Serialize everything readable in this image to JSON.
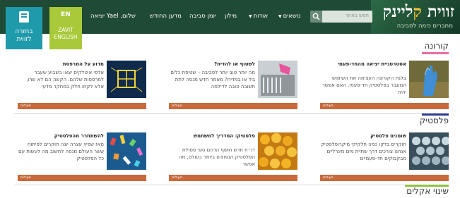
{
  "header": {
    "logo_main": "זווית",
    "logo_accent": "ק",
    "logo_rest": "ליינ",
    "logo_tail": "ק",
    "logo_subtitle": "מחברים כימה לסביבה",
    "search_placeholder": "חפש באתר",
    "nav": {
      "topics": "נושאים",
      "about": "אודות",
      "glossary": "מילון",
      "diary": "יומן סביבה",
      "monthly": "מדען החודש"
    },
    "user_text": "שלום, Yael  יציאה",
    "en_label": "EN",
    "en_sub": "ZAVIT ENGLISH",
    "choose_line1": "בחזרה",
    "choose_line2": "לזווית"
  },
  "sections": [
    {
      "title": "קורונה",
      "color": "#e86fa0",
      "cards": [
        {
          "title": "אסטרטגיית יציאה מהחד-פעמי",
          "text": "בלנת הקורונה העצימה את השימוש המוגבר בפלסטיק חד-פעמי. האם אפשר יהיה",
          "tag": "פעילות"
        },
        {
          "title": "לשטוף או להדיח?",
          "text": "מה יותר טוב יותר לסביבה – שטיפת כלים ביד או במדיח? מאמר חדש מנסה לתת תשובה טובה לדילמה",
          "tag": "פעילות"
        },
        {
          "title": "מדוע על המרפסת",
          "text": "אלפי איטלקים יצאו בשבוע שעבר למרפסות שלהם. הקשה הם לא שרו, אלא לקחו חלק במחקר מדעי",
          "tag": "פעילות"
        }
      ]
    },
    {
      "title": "פלסטיק",
      "color": "#2a3a8f",
      "cards": [
        {
          "title": "שומנים פלסטיק",
          "text": "חוקרים בדקו כמה חלקיקי מיקרופלסטיק אנחנו צורכים דרך שתיית מים מינרליים מבקבוקים חד-פעמיים",
          "tag": "פעילות"
        },
        {
          "title": "פלסטיק: המדריך למשתמש",
          "text": "דו״ח חדש חושף הדהם סוגי פסולת הפלסטיק הנפוצים ביותר בעולם, מה אפשר",
          "tag": "פעילות"
        },
        {
          "title": "להשתחרר מהפלסטיק",
          "text": "מאז שפיץ עצרה יונה חוקרים לפיתוח ששר העולם מנסה לחשוב מה לעשות עם כל הפלסטיק",
          "tag": "פעילות"
        }
      ]
    },
    {
      "title": "שינוי אקלים",
      "color": "#8fc23e"
    }
  ]
}
